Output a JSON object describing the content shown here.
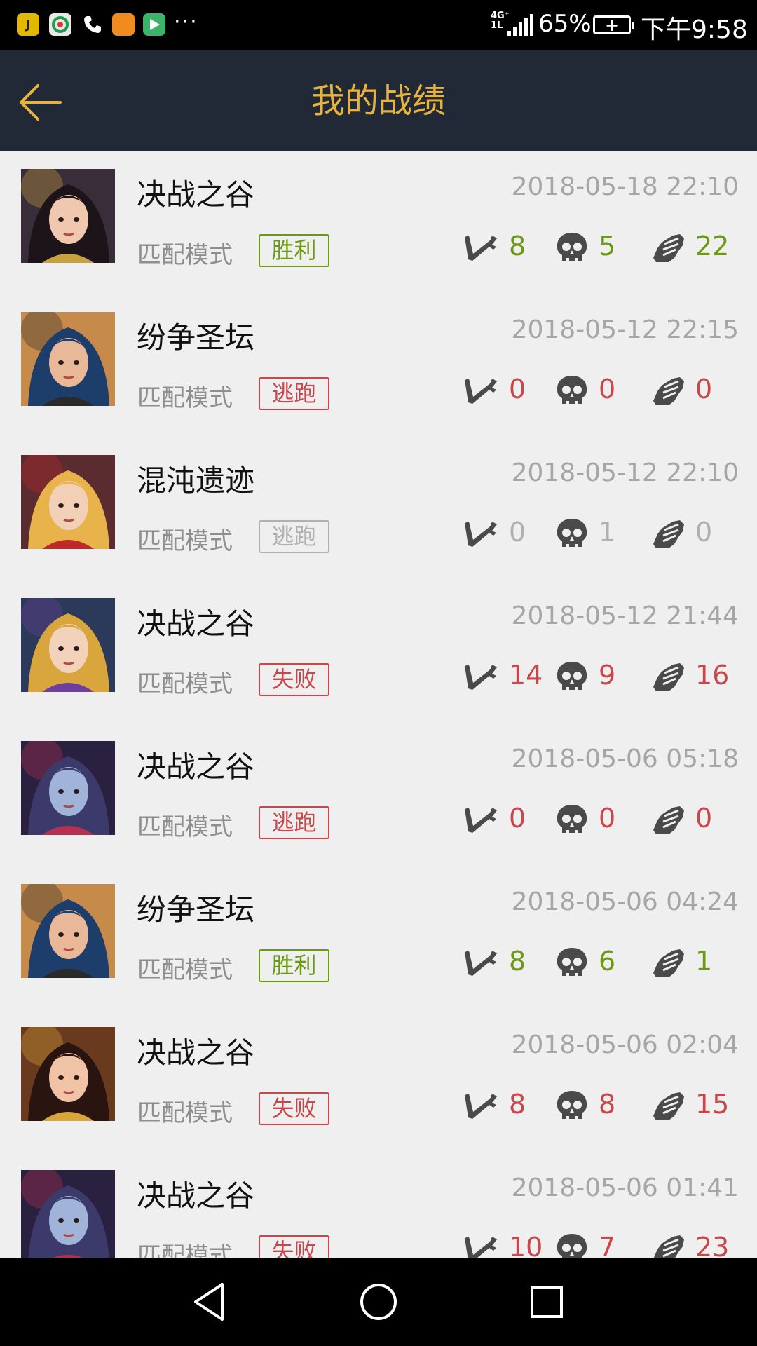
{
  "status_bar": {
    "apps": [
      {
        "icon": "j-app-icon",
        "letter": "J",
        "color": "#e3b800"
      },
      {
        "icon": "music-app-icon",
        "letter": "",
        "color": "#e8e8e8"
      },
      {
        "icon": "phone-icon",
        "letter": "",
        "color": "#000000"
      },
      {
        "icon": "video-app-icon",
        "letter": "",
        "color": "#f08c1e"
      },
      {
        "icon": "play-app-icon",
        "letter": "",
        "color": "#3bb36b"
      }
    ],
    "more": "···",
    "network": "4G⁺",
    "network_sub": "1L",
    "battery_percent": "65%",
    "time": "下午9:58"
  },
  "header": {
    "title": "我的战绩",
    "back_icon": "back-arrow-icon"
  },
  "colors": {
    "win": "#6a9a12",
    "loss": "#c9474b",
    "escape_dim": "#b0b0b0",
    "title_bar": "#222936",
    "title_text": "#e8b33c"
  },
  "matches": [
    {
      "map": "决战之谷",
      "time": "2018-05-18 22:10",
      "mode": "匹配模式",
      "result": "胜利",
      "style": "win",
      "kills": "8",
      "deaths": "5",
      "assists": "22",
      "avatar": "hero-a"
    },
    {
      "map": "纷争圣坛",
      "time": "2018-05-12 22:15",
      "mode": "匹配模式",
      "result": "逃跑",
      "style": "loss",
      "kills": "0",
      "deaths": "0",
      "assists": "0",
      "avatar": "hero-b"
    },
    {
      "map": "混沌遗迹",
      "time": "2018-05-12 22:10",
      "mode": "匹配模式",
      "result": "逃跑",
      "style": "dim",
      "kills": "0",
      "deaths": "1",
      "assists": "0",
      "avatar": "hero-c"
    },
    {
      "map": "决战之谷",
      "time": "2018-05-12 21:44",
      "mode": "匹配模式",
      "result": "失败",
      "style": "loss",
      "kills": "14",
      "deaths": "9",
      "assists": "16",
      "avatar": "hero-d"
    },
    {
      "map": "决战之谷",
      "time": "2018-05-06 05:18",
      "mode": "匹配模式",
      "result": "逃跑",
      "style": "loss",
      "kills": "0",
      "deaths": "0",
      "assists": "0",
      "avatar": "hero-e"
    },
    {
      "map": "纷争圣坛",
      "time": "2018-05-06 04:24",
      "mode": "匹配模式",
      "result": "胜利",
      "style": "win",
      "kills": "8",
      "deaths": "6",
      "assists": "1",
      "avatar": "hero-b"
    },
    {
      "map": "决战之谷",
      "time": "2018-05-06 02:04",
      "mode": "匹配模式",
      "result": "失败",
      "style": "loss",
      "kills": "8",
      "deaths": "8",
      "assists": "15",
      "avatar": "hero-f"
    },
    {
      "map": "决战之谷",
      "time": "2018-05-06 01:41",
      "mode": "匹配模式",
      "result": "失败",
      "style": "loss",
      "kills": "10",
      "deaths": "7",
      "assists": "23",
      "avatar": "hero-e"
    }
  ],
  "nav": {
    "back": "nav-back-icon",
    "home": "nav-home-icon",
    "recents": "nav-recents-icon"
  }
}
